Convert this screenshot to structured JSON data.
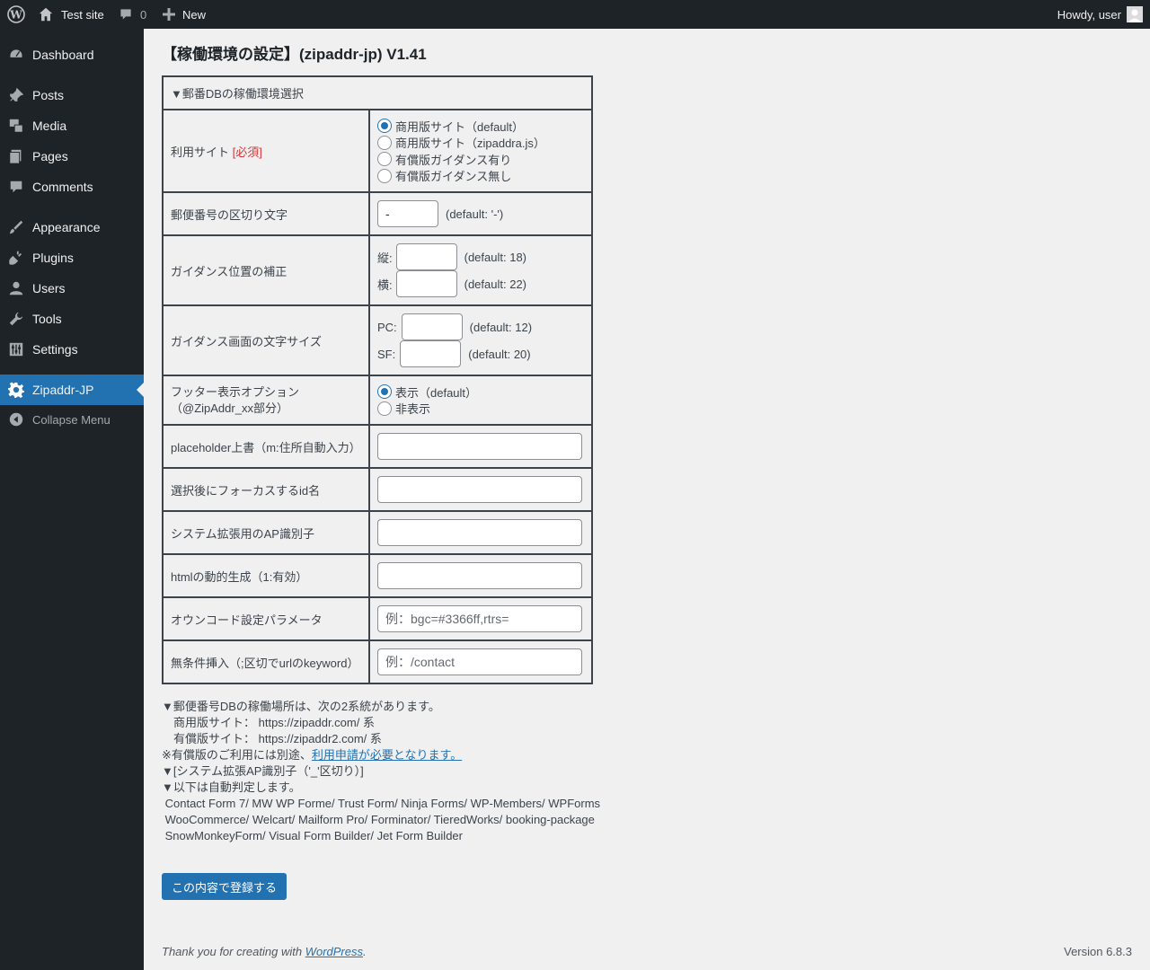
{
  "adminbar": {
    "site_name": "Test site",
    "comments_count": "0",
    "new_label": "New",
    "howdy": "Howdy, user"
  },
  "sidebar": {
    "items": [
      {
        "label": "Dashboard",
        "icon": "dashboard-icon"
      },
      {
        "label": "Posts",
        "icon": "pin-icon"
      },
      {
        "label": "Media",
        "icon": "media-icon"
      },
      {
        "label": "Pages",
        "icon": "pages-icon"
      },
      {
        "label": "Comments",
        "icon": "comment-icon"
      },
      {
        "label": "Appearance",
        "icon": "brush-icon"
      },
      {
        "label": "Plugins",
        "icon": "plug-icon"
      },
      {
        "label": "Users",
        "icon": "user-icon"
      },
      {
        "label": "Tools",
        "icon": "wrench-icon"
      },
      {
        "label": "Settings",
        "icon": "sliders-icon"
      },
      {
        "label": "Zipaddr-JP",
        "icon": "gear-icon",
        "current": true
      }
    ],
    "collapse_label": "Collapse Menu"
  },
  "page": {
    "title": "【稼働環境の設定】(zipaddr-jp) V1.41"
  },
  "form": {
    "section_header": "▼郵番DBの稼働環境選択",
    "site": {
      "label": "利用サイト ",
      "required": "[必須]",
      "options": [
        {
          "label": "商用版サイト（default）",
          "checked": true
        },
        {
          "label": "商用版サイト（zipaddra.js）",
          "checked": false
        },
        {
          "label": "有償版ガイダンス有り",
          "checked": false
        },
        {
          "label": "有償版ガイダンス無し",
          "checked": false
        }
      ]
    },
    "separator": {
      "label": "郵便番号の区切り文字",
      "value": "-",
      "hint": "(default: '-')"
    },
    "position": {
      "label": "ガイダンス位置の補正",
      "v_label": "縦:",
      "v_value": "",
      "v_hint": "(default: 18)",
      "h_label": "横:",
      "h_value": "",
      "h_hint": "(default: 22)"
    },
    "fontsize": {
      "label": "ガイダンス画面の文字サイズ",
      "pc_label": "PC:",
      "pc_value": "",
      "pc_hint": "(default: 12)",
      "sf_label": "SF:",
      "sf_value": "",
      "sf_hint": "(default: 20)"
    },
    "footer": {
      "label_line1": "フッター表示オプション",
      "label_line2": "（@ZipAddr_xx部分）",
      "options": [
        {
          "label": "表示（default）",
          "checked": true
        },
        {
          "label": "非表示",
          "checked": false
        }
      ]
    },
    "placeholder": {
      "label": "placeholder上書（m:住所自動入力）",
      "value": ""
    },
    "focus": {
      "label": "選択後にフォーカスするid名",
      "value": ""
    },
    "ap_id": {
      "label": "システム拡張用のAP識別子",
      "value": ""
    },
    "dynamic": {
      "label": "htmlの動的生成（1:有効）",
      "value": ""
    },
    "owncode": {
      "label": "オウンコード設定パラメータ",
      "value": "",
      "placeholder": "例：bgc=#3366ff,rtrs="
    },
    "unconditional": {
      "label": "無条件挿入（;区切でurlのkeyword）",
      "value": "",
      "placeholder": "例：/contact"
    }
  },
  "notes": {
    "line1": "▼郵便番号DBの稼働場所は、次の2系統があります。",
    "line2": "　商用版サイト： https://zipaddr.com/ 系",
    "line3": "　有償版サイト： https://zipaddr2.com/ 系",
    "line4_prefix": "※有償版のご利用には別途、",
    "line4_link": "利用申請が必要となります。",
    "line5": "▼[システム拡張AP識別子（'_'区切り）]",
    "line6": "▼以下は自動判定します。",
    "line7": " Contact Form 7/ MW WP Forme/ Trust Form/ Ninja Forms/ WP-Members/ WPForms",
    "line8": " WooCommerce/ Welcart/ Mailform Pro/ Forminator/ TieredWorks/ booking-package",
    "line9": " SnowMonkeyForm/ Visual Form Builder/ Jet Form Builder"
  },
  "submit_label": "この内容で登録する",
  "footer": {
    "thanks_prefix": "Thank you for creating with ",
    "thanks_link": "WordPress",
    "thanks_suffix": ".",
    "version": "Version 6.8.3"
  },
  "colors": {
    "admin_dark": "#1d2327",
    "accent": "#2271b1",
    "required": "#d63638",
    "background": "#f0f0f1"
  }
}
